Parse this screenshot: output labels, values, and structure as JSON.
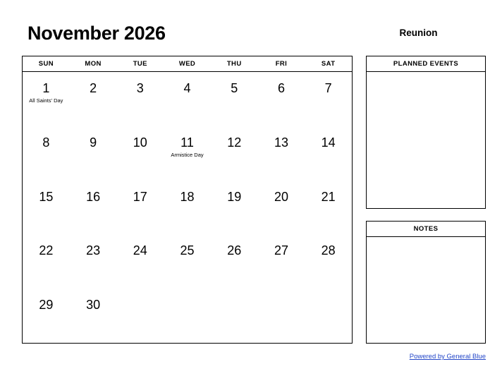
{
  "header": {
    "month_title": "November 2026",
    "region": "Reunion"
  },
  "calendar": {
    "weekdays": [
      "SUN",
      "MON",
      "TUE",
      "WED",
      "THU",
      "FRI",
      "SAT"
    ],
    "weeks": [
      [
        {
          "day": "1",
          "event": "All Saints' Day"
        },
        {
          "day": "2",
          "event": ""
        },
        {
          "day": "3",
          "event": ""
        },
        {
          "day": "4",
          "event": ""
        },
        {
          "day": "5",
          "event": ""
        },
        {
          "day": "6",
          "event": ""
        },
        {
          "day": "7",
          "event": ""
        }
      ],
      [
        {
          "day": "8",
          "event": ""
        },
        {
          "day": "9",
          "event": ""
        },
        {
          "day": "10",
          "event": ""
        },
        {
          "day": "11",
          "event": "Armistice Day"
        },
        {
          "day": "12",
          "event": ""
        },
        {
          "day": "13",
          "event": ""
        },
        {
          "day": "14",
          "event": ""
        }
      ],
      [
        {
          "day": "15",
          "event": ""
        },
        {
          "day": "16",
          "event": ""
        },
        {
          "day": "17",
          "event": ""
        },
        {
          "day": "18",
          "event": ""
        },
        {
          "day": "19",
          "event": ""
        },
        {
          "day": "20",
          "event": ""
        },
        {
          "day": "21",
          "event": ""
        }
      ],
      [
        {
          "day": "22",
          "event": ""
        },
        {
          "day": "23",
          "event": ""
        },
        {
          "day": "24",
          "event": ""
        },
        {
          "day": "25",
          "event": ""
        },
        {
          "day": "26",
          "event": ""
        },
        {
          "day": "27",
          "event": ""
        },
        {
          "day": "28",
          "event": ""
        }
      ],
      [
        {
          "day": "29",
          "event": ""
        },
        {
          "day": "30",
          "event": ""
        },
        {
          "day": "",
          "event": ""
        },
        {
          "day": "",
          "event": ""
        },
        {
          "day": "",
          "event": ""
        },
        {
          "day": "",
          "event": ""
        },
        {
          "day": "",
          "event": ""
        }
      ]
    ]
  },
  "panels": {
    "planned_events_title": "PLANNED EVENTS",
    "planned_events_body": "",
    "notes_title": "NOTES",
    "notes_body": ""
  },
  "footer": {
    "link_label": "Powered by General Blue",
    "link_color": "#2346c8"
  }
}
